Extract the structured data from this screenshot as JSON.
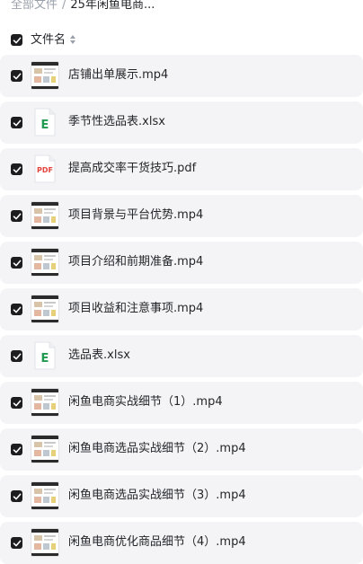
{
  "breadcrumb": {
    "root": "全部文件",
    "separator": "/",
    "current": "25年闲鱼电商..."
  },
  "header": {
    "column_label": "文件名",
    "sort_icon": "sort-icon",
    "all_checked": true
  },
  "files": [
    {
      "name": "店铺出单展示.mp4",
      "type": "video",
      "checked": true
    },
    {
      "name": "季节性选品表.xlsx",
      "type": "xlsx",
      "checked": true
    },
    {
      "name": "提高成交率干货技巧.pdf",
      "type": "pdf",
      "checked": true
    },
    {
      "name": "项目背景与平台优势.mp4",
      "type": "video",
      "checked": true
    },
    {
      "name": "项目介绍和前期准备.mp4",
      "type": "video",
      "checked": true
    },
    {
      "name": "项目收益和注意事项.mp4",
      "type": "video",
      "checked": true
    },
    {
      "name": "选品表.xlsx",
      "type": "xlsx",
      "checked": true
    },
    {
      "name": "闲鱼电商实战细节（1）.mp4",
      "type": "video",
      "checked": true
    },
    {
      "name": "闲鱼电商选品实战细节（2）.mp4",
      "type": "video",
      "checked": true
    },
    {
      "name": "闲鱼电商选品实战细节（3）.mp4",
      "type": "video",
      "checked": true
    },
    {
      "name": "闲鱼电商优化商品细节（4）.mp4",
      "type": "video",
      "checked": true
    }
  ],
  "icons": {
    "xlsx_letter": "E",
    "pdf_letter": "PDF"
  },
  "colors": {
    "checkbox": "#1d1d1f",
    "row_bg": "#f4f4f6",
    "xlsx_green": "#1f9a4f",
    "pdf_red": "#e5413a"
  }
}
